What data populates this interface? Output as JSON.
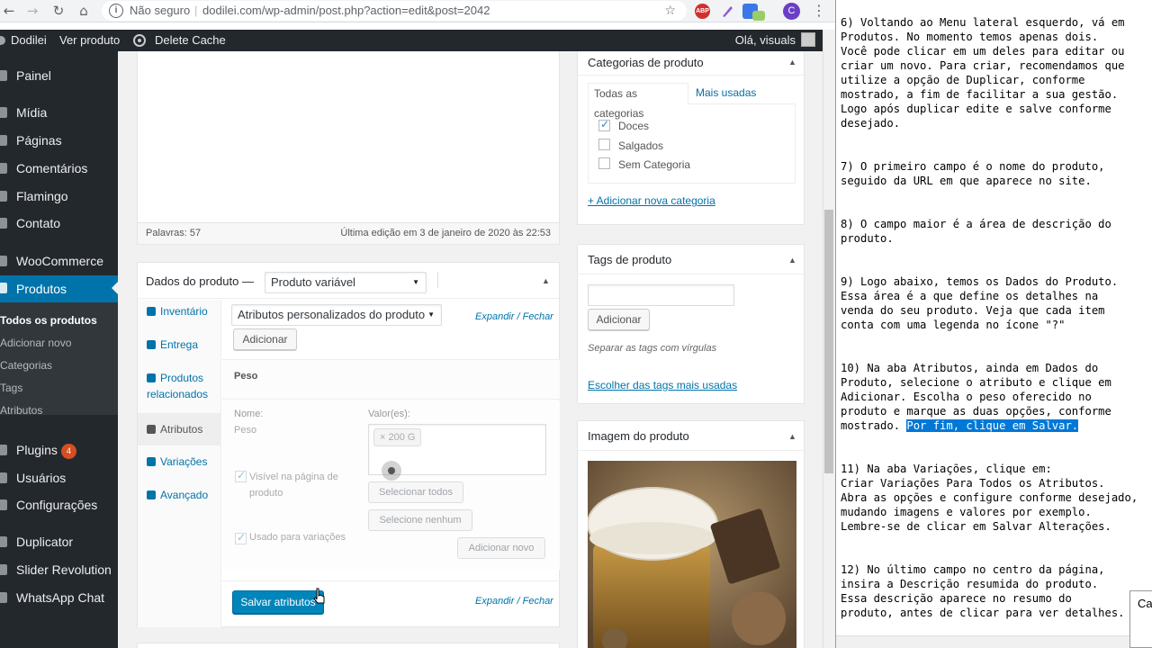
{
  "browser": {
    "insecure_label": "Não seguro",
    "url": "dodilei.com/wp-admin/post.php?action=edit&post=2042",
    "profile_initial": "C",
    "ext_abp": "ABP"
  },
  "adminbar": {
    "site": "Dodilei",
    "view_product": "Ver produto",
    "delete_cache": "Delete Cache",
    "greeting": "Olá, visuals"
  },
  "sidebar": {
    "items": [
      {
        "label": "Painel"
      },
      {
        "label": "Mídia"
      },
      {
        "label": "Páginas"
      },
      {
        "label": "Comentários"
      },
      {
        "label": "Flamingo"
      },
      {
        "label": "Contato"
      },
      {
        "label": "WooCommerce"
      },
      {
        "label": "Produtos"
      },
      {
        "label": "Plugins",
        "badge": "4"
      },
      {
        "label": "Usuários"
      },
      {
        "label": "Configurações"
      },
      {
        "label": "Duplicator"
      },
      {
        "label": "Slider Revolution"
      },
      {
        "label": "WhatsApp Chat"
      }
    ],
    "submenu": [
      "Todos os produtos",
      "Adicionar novo",
      "Categorias",
      "Tags",
      "Atributos"
    ]
  },
  "editor": {
    "words": "Palavras: 57",
    "last_edit": "Última edição em 3 de janeiro de 2020 às 22:53"
  },
  "product_data": {
    "title": "Dados do produto —",
    "type_select": "Produto variável",
    "tabs": [
      "Inventário",
      "Entrega",
      "Produtos relacionados",
      "Atributos",
      "Variações",
      "Avançado"
    ],
    "attr_select": "Atributos personalizados do produto",
    "expand_close": "Expandir",
    "slash": "/",
    "close": "Fechar",
    "add_button": "Adicionar",
    "attr_name_heading": "Peso",
    "name_label": "Nome:",
    "name_value": "Peso",
    "values_label": "Valor(es):",
    "value_tag": "× 200 G",
    "visible_label": "Visível na página de produto",
    "select_all": "Selecionar todos",
    "select_none": "Selecione nenhum",
    "used_for_variations": "Usado para variações",
    "add_new": "Adicionar novo",
    "save_attributes": "Salvar atributos"
  },
  "categories": {
    "title": "Categorias de produto",
    "tab_all": "Todas as categorias",
    "tab_used": "Mais usadas",
    "items": [
      {
        "label": "Doces",
        "checked": true
      },
      {
        "label": "Salgados",
        "checked": false
      },
      {
        "label": "Sem Categoria",
        "checked": false
      }
    ],
    "add_new": "+ Adicionar nova categoria"
  },
  "tags": {
    "title": "Tags de produto",
    "add_button": "Adicionar",
    "hint": "Separar as tags com vírgulas",
    "choose": "Escolher das tags mais usadas"
  },
  "image": {
    "title": "Imagem do produto"
  },
  "notes": {
    "before": "6) Voltando ao Menu lateral esquerdo, vá em\nProdutos. No momento temos apenas dois.\nVocê pode clicar em um deles para editar ou\ncriar um novo. Para criar, recomendamos que\nutilize a opção de Duplicar, conforme\nmostrado, a fim de facilitar a sua gestão.\nLogo após duplicar edite e salve conforme\ndesejado.\n\n\n7) O primeiro campo é o nome do produto,\nseguido da URL em que aparece no site.\n\n\n8) O campo maior é a área de descrição do\nproduto.\n\n\n9) Logo abaixo, temos os Dados do Produto.\nEssa área é a que define os detalhes na\nvenda do seu produto. Veja que cada item\nconta com uma legenda no ícone \"?\"\n\n\n10) Na aba Atributos, ainda em Dados do\nProduto, selecione o atributo e clique em\nAdicionar. Escolha o peso oferecido no\nproduto e marque as duas opções, conforme\nmostrado. ",
    "highlight": "Por fim, clique em Salvar.",
    "after": "\n\n\n11) Na aba Variações, clique em:\nCriar Variações Para Todos os Atributos.\nAbra as opções e configure conforme desejado,\nmudando imagens e valores por exemplo.\nLembre-se de clicar em Salvar Alterações.\n\n\n12) No último campo no centro da página,\ninsira a Descrição resumida do produto.\nEssa descrição aparece no resumo do\nproduto, antes de clicar para ver detalhes.",
    "popup": "Ca"
  },
  "icons": [
    "back-icon",
    "forward-icon",
    "reload-icon",
    "home-icon",
    "info-icon",
    "star-icon",
    "cursor-icon",
    "upload-icon"
  ],
  "colors": {
    "admin_bg": "#23282d",
    "accent": "#0073aa",
    "button_primary": "#0085ba",
    "highlight": "#0078d7"
  }
}
